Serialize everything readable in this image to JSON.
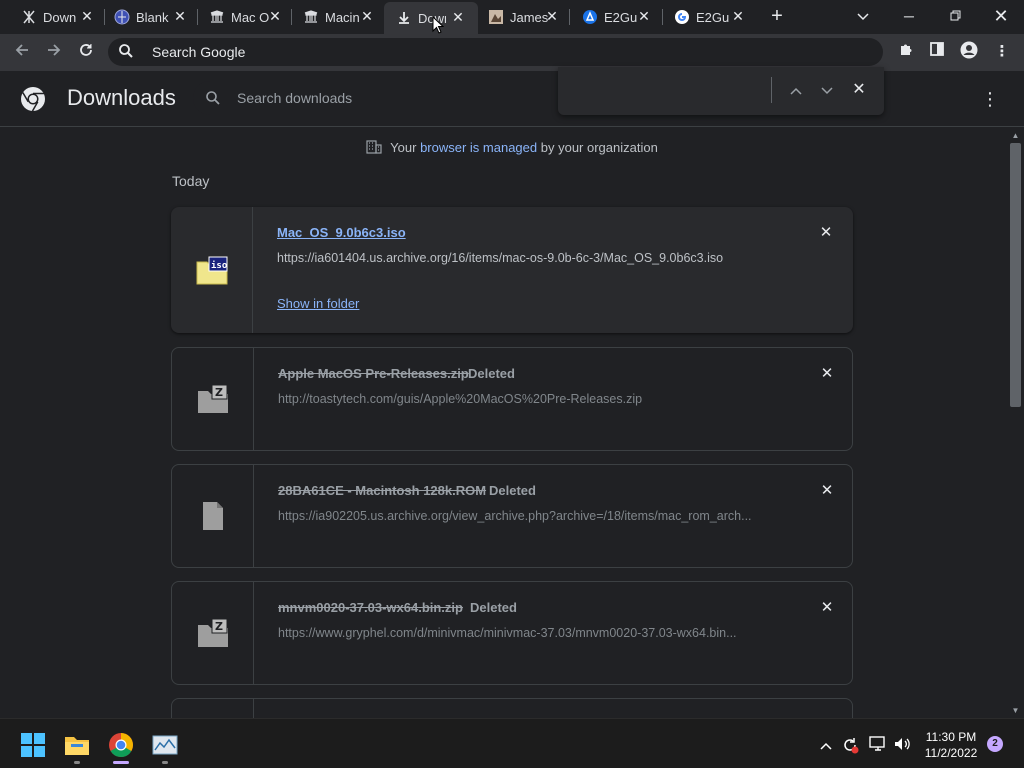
{
  "tabs": [
    {
      "label": "Down",
      "icon": "archive-org-icon",
      "active": false
    },
    {
      "label": "Blank",
      "icon": "globe-icon",
      "active": false
    },
    {
      "label": "Mac O",
      "icon": "archive-building-icon",
      "active": false
    },
    {
      "label": "Macin",
      "icon": "archive-building-icon",
      "active": false
    },
    {
      "label": "Down",
      "icon": "download-icon",
      "active": true
    },
    {
      "label": "James",
      "icon": "photo-icon",
      "active": false
    },
    {
      "label": "E2Gu",
      "icon": "e2-icon",
      "active": false
    },
    {
      "label": "E2Gu",
      "icon": "google-icon",
      "active": false
    }
  ],
  "omnibox": {
    "placeholder": "Search Google"
  },
  "page": {
    "title": "Downloads",
    "search_placeholder": "Search downloads",
    "managed_prefix": "Your",
    "managed_link": "browser is managed",
    "managed_suffix": "by your organization",
    "section_today": "Today"
  },
  "downloads": [
    {
      "name": "Mac_OS_9.0b6c3.iso",
      "url": "https://ia601404.us.archive.org/16/items/mac-os-9.0b-6c-3/Mac_OS_9.0b6c3.iso",
      "status": "",
      "action": "Show in folder",
      "icon": "iso-file-icon"
    },
    {
      "name": "Apple MacOS Pre-Releases.zip",
      "url": "http://toastytech.com/guis/Apple%20MacOS%20Pre-Releases.zip",
      "status": "Deleted",
      "icon": "zip-file-icon"
    },
    {
      "name": "28BA61CE - Macintosh 128k.ROM",
      "url": "https://ia902205.us.archive.org/view_archive.php?archive=/18/items/mac_rom_arch...",
      "status": "Deleted",
      "icon": "generic-file-icon"
    },
    {
      "name": "mnvm0020-37.03-wx64.bin.zip",
      "url": "https://www.gryphel.com/d/minivmac/minivmac-37.03/mnvm0020-37.03-wx64.bin...",
      "status": "Deleted",
      "icon": "zip-file-icon"
    }
  ],
  "taskbar": {
    "time": "11:30 PM",
    "date": "11/2/2022",
    "notifications": "2"
  },
  "colors": {
    "accent": "#8ab4f8",
    "bg": "#202124",
    "card": "#292a2d"
  }
}
